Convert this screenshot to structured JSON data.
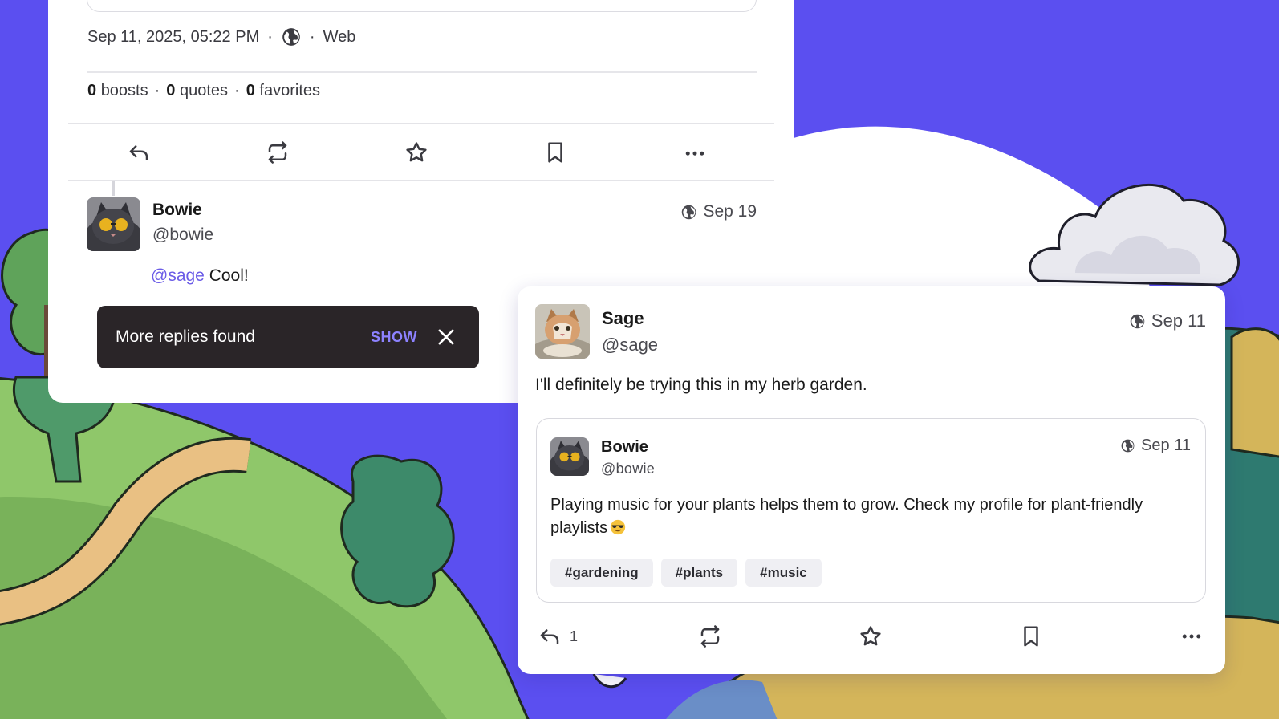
{
  "colors": {
    "sky": "#5b4ff0",
    "accent": "#6b5ce7",
    "toast_bg": "#2a2528",
    "toast_action": "#8d82ff"
  },
  "status_detail": {
    "timestamp": "Sep 11, 2025, 05:22 PM",
    "visibility_icon": "globe-icon",
    "client": "Web",
    "separator": "·",
    "stats": [
      {
        "count": "0",
        "label": "boosts"
      },
      {
        "count": "0",
        "label": "quotes"
      },
      {
        "count": "0",
        "label": "favorites"
      }
    ],
    "actions": [
      "reply-icon",
      "boost-icon",
      "favorite-icon",
      "bookmark-icon",
      "more-icon"
    ]
  },
  "reply": {
    "author_name": "Bowie",
    "author_handle": "@bowie",
    "date": "Sep 19",
    "mention": "@sage",
    "text": " Cool!"
  },
  "toast": {
    "message": "More replies found",
    "action": "SHOW"
  },
  "card": {
    "author_name": "Sage",
    "author_handle": "@sage",
    "date": "Sep 11",
    "text": "I'll definitely be trying this in my herb garden.",
    "quoted": {
      "author_name": "Bowie",
      "author_handle": "@bowie",
      "date": "Sep 11",
      "text": "Playing music for your plants helps them to grow. Check my profile for plant-friendly playlists",
      "emoji": "smiling-face-with-sunglasses",
      "hashtags": [
        "#gardening",
        "#plants",
        "#music"
      ]
    },
    "reply_count": "1"
  }
}
